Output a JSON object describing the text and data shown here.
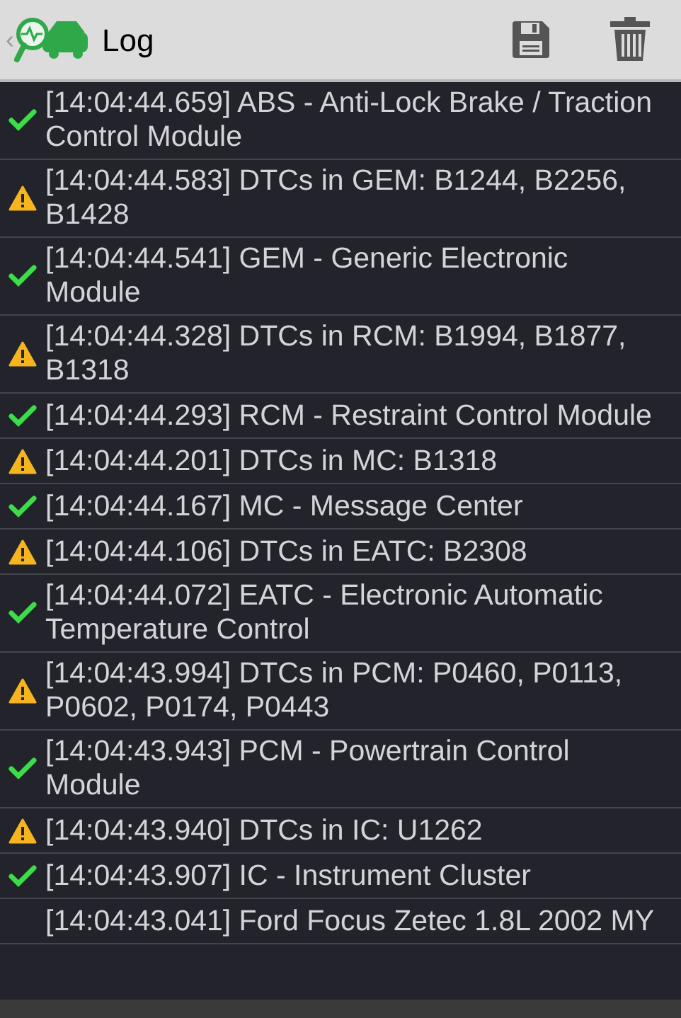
{
  "app_bar": {
    "back": "‹",
    "title": "Log"
  },
  "entries": [
    {
      "kind": "ok",
      "text": "[14:04:44.659] ABS - Anti-Lock Brake / Traction Control Module"
    },
    {
      "kind": "warning",
      "text": "[14:04:44.583] DTCs in GEM: B1244, B2256, B1428"
    },
    {
      "kind": "ok",
      "text": "[14:04:44.541] GEM - Generic Electronic Module"
    },
    {
      "kind": "warning",
      "text": "[14:04:44.328] DTCs in RCM: B1994, B1877, B1318"
    },
    {
      "kind": "ok",
      "text": "[14:04:44.293] RCM - Restraint Control Module"
    },
    {
      "kind": "warning",
      "text": "[14:04:44.201] DTCs in MC: B1318"
    },
    {
      "kind": "ok",
      "text": "[14:04:44.167] MC - Message Center"
    },
    {
      "kind": "warning",
      "text": "[14:04:44.106] DTCs in EATC: B2308"
    },
    {
      "kind": "ok",
      "text": "[14:04:44.072] EATC - Electronic Automatic Temperature Control"
    },
    {
      "kind": "warning",
      "text": "[14:04:43.994] DTCs in PCM: P0460, P0113, P0602, P0174, P0443"
    },
    {
      "kind": "ok",
      "text": "[14:04:43.943] PCM - Powertrain Control Module"
    },
    {
      "kind": "warning",
      "text": "[14:04:43.940] DTCs in IC: U1262"
    },
    {
      "kind": "ok",
      "text": "[14:04:43.907] IC - Instrument Cluster"
    },
    {
      "kind": "info",
      "text": "[14:04:43.041] Ford Focus Zetec 1.8L 2002 MY"
    }
  ]
}
